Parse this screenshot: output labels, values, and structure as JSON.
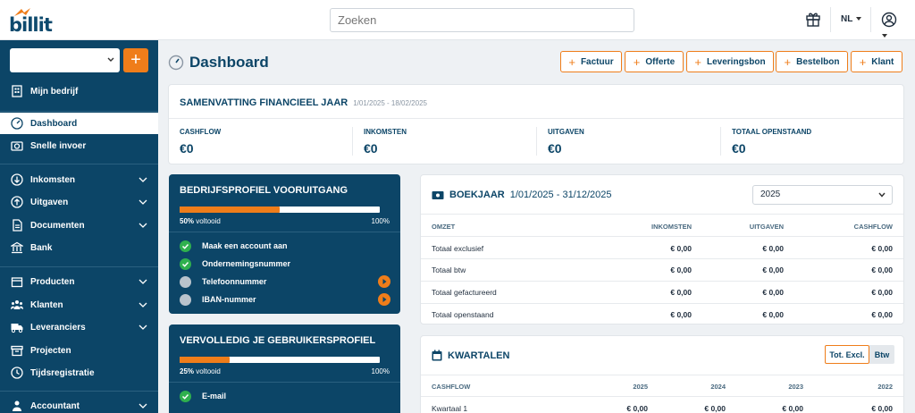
{
  "header": {
    "logo_text": "billit",
    "search_placeholder": "Zoeken",
    "language": "NL"
  },
  "colors": {
    "brand": "#0c4567",
    "accent": "#ef7d1a",
    "success": "#2fb04e"
  },
  "sidebar": {
    "company_select_value": "",
    "items": [
      {
        "label": "Mijn bedrijf",
        "icon": "building-icon"
      },
      {
        "label": "Dashboard",
        "icon": "dashboard-icon",
        "active": true
      },
      {
        "label": "Snelle invoer",
        "icon": "camera-icon"
      },
      {
        "label": "Inkomsten",
        "icon": "arrow-down-circle-icon"
      },
      {
        "label": "Uitgaven",
        "icon": "arrow-up-circle-icon"
      },
      {
        "label": "Documenten",
        "icon": "document-icon"
      },
      {
        "label": "Bank",
        "icon": "bank-icon"
      },
      {
        "label": "Producten",
        "icon": "box-icon"
      },
      {
        "label": "Klanten",
        "icon": "users-icon"
      },
      {
        "label": "Leveranciers",
        "icon": "truck-icon"
      },
      {
        "label": "Projecten",
        "icon": "folder-icon"
      },
      {
        "label": "Tijdsregistratie",
        "icon": "clock-icon"
      },
      {
        "label": "Accountant",
        "icon": "person-icon"
      }
    ]
  },
  "main": {
    "title": "Dashboard",
    "actions": [
      "Factuur",
      "Offerte",
      "Leveringsbon",
      "Bestelbon",
      "Klant"
    ],
    "summary": {
      "title": "SAMENVATTING FINANCIEEL JAAR",
      "date": "1/01/2025 - 18/02/2025",
      "kpis": [
        {
          "label": "CASHFLOW",
          "value": "€0"
        },
        {
          "label": "INKOMSTEN",
          "value": "€0"
        },
        {
          "label": "UITGAVEN",
          "value": "€0"
        },
        {
          "label": "TOTAAL OPENSTAAND",
          "value": "€0"
        }
      ]
    },
    "profile1": {
      "title": "BEDRIJFSPROFIEL VOORUITGANG",
      "percent": "50%",
      "done_label": "voltooid",
      "max": "100%",
      "progress": 0.5,
      "steps": [
        {
          "label": "Maak een account aan",
          "done": true
        },
        {
          "label": "Ondernemingsnummer",
          "done": true
        },
        {
          "label": "Telefoonnummer",
          "done": false
        },
        {
          "label": "IBAN-nummer",
          "done": false
        }
      ]
    },
    "profile2": {
      "title": "VERVOLLEDIG JE GEBRUIKERSPROFIEL",
      "percent": "25%",
      "done_label": "voltooid",
      "max": "100%",
      "progress": 0.25,
      "steps": [
        {
          "label": "E-mail",
          "done": true
        }
      ]
    },
    "boekjaar": {
      "title": "BOEKJAAR",
      "range": "1/01/2025 - 31/12/2025",
      "year_select": "2025",
      "headers": [
        "OMZET",
        "INKOMSTEN",
        "UITGAVEN",
        "CASHFLOW"
      ],
      "rows": [
        {
          "label": "Totaal exclusief",
          "values": [
            "€ 0,00",
            "€ 0,00",
            "€ 0,00"
          ]
        },
        {
          "label": "Totaal btw",
          "values": [
            "€ 0,00",
            "€ 0,00",
            "€ 0,00"
          ]
        },
        {
          "label": "Totaal gefactureerd",
          "values": [
            "€ 0,00",
            "€ 0,00",
            "€ 0,00"
          ]
        },
        {
          "label": "Totaal openstaand",
          "values": [
            "€ 0,00",
            "€ 0,00",
            "€ 0,00"
          ]
        }
      ]
    },
    "kwartalen": {
      "title": "KWARTALEN",
      "toggle_a": "Tot. Excl.",
      "toggle_b": "Btw",
      "headers": [
        "CASHFLOW",
        "2025",
        "2024",
        "2023",
        "2022"
      ],
      "rows": [
        {
          "label": "Kwartaal 1",
          "values": [
            "€ 0,00",
            "€ 0,00",
            "€ 0,00",
            "€ 0,00"
          ]
        }
      ]
    }
  }
}
